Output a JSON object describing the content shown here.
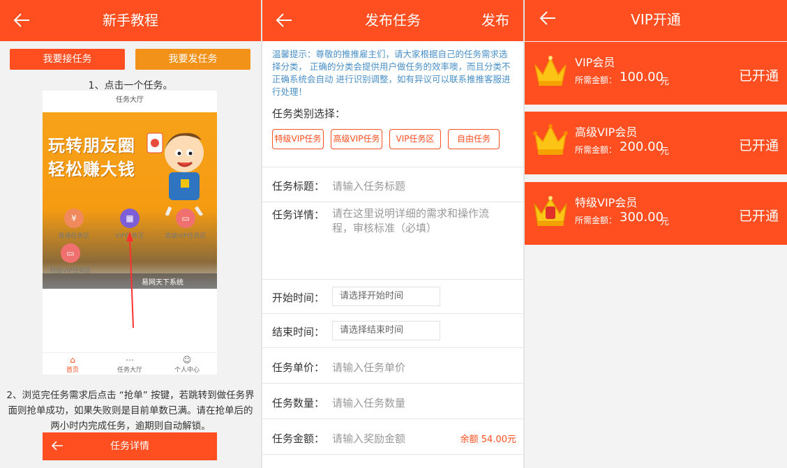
{
  "tutorial": {
    "title": "新手教程",
    "btn_accept": "我要接任务",
    "btn_post": "我要发任务",
    "step1": "1、点击一个任务。",
    "phone": {
      "title": "任务大厅",
      "banner_line1": "玩转朋友圈",
      "banner_line2": "轻松赚大钱",
      "banner_footer": "易网天下系统",
      "grid": [
        {
          "label": "普通任务区",
          "color": "#f08a5d"
        },
        {
          "label": "VIP任务区",
          "color": "#7b5ed8"
        },
        {
          "label": "高级VIP任务区",
          "color": "#f07070"
        },
        {
          "label": "特级VIP任务区",
          "color": "#f07070"
        }
      ],
      "tabs": [
        "首页",
        "任务大厅",
        "个人中心"
      ]
    },
    "step2": "2、浏览完任务需求后点击 “抢单” 按键，若跳转到做任务界面则抢单成功，如果失败则是目前单数已满。请在抢单后的两小时内完成任务，逾期则自动解锁。",
    "detail_title": "任务详情"
  },
  "publish": {
    "title": "发布任务",
    "action": "发布",
    "tip": "温馨提示：尊敬的推推雇主们，请大家根据自己的任务需求选择分类， 正确的分类会提供用户做任务的效率噢，而且分类不正确系统会自动 进行识别调整，如有异议可以联系推推客服进行处理！",
    "category_label": "任务类别选择：",
    "categories": [
      "特级VIP任务",
      "高级VIP任务",
      "VIP任务区",
      "自由任务"
    ],
    "fields": {
      "title_label": "任务标题：",
      "title_placeholder": "请输入任务标题",
      "detail_label": "任务详情：",
      "detail_placeholder": "请在这里说明详细的需求和操作流程，审核标准（必填）",
      "start_label": "开始时间：",
      "start_placeholder": "请选择开始时间",
      "end_label": "结束时间：",
      "end_placeholder": "请选择结束时间",
      "price_label": "任务单价：",
      "price_placeholder": "请输入任务单价",
      "qty_label": "任务数量：",
      "qty_placeholder": "请输入任务数量",
      "amount_label": "任务金额：",
      "amount_placeholder": "请输入奖励金额",
      "balance": "余额 54.00元"
    }
  },
  "vip": {
    "title": "VIP开通",
    "amount_label": "所需金额：",
    "unit": "元",
    "levels": [
      {
        "name": "VIP会员",
        "amount": "100.00",
        "status": "已开通"
      },
      {
        "name": "高级VIP会员",
        "amount": "200.00",
        "status": "已开通"
      },
      {
        "name": "特级VIP会员",
        "amount": "300.00",
        "status": "已开通"
      }
    ]
  },
  "colors": {
    "brand": "#ff4e1f",
    "orange_button": "#f39218",
    "tip_text": "#4a90c8",
    "crown": "#fcc516"
  }
}
